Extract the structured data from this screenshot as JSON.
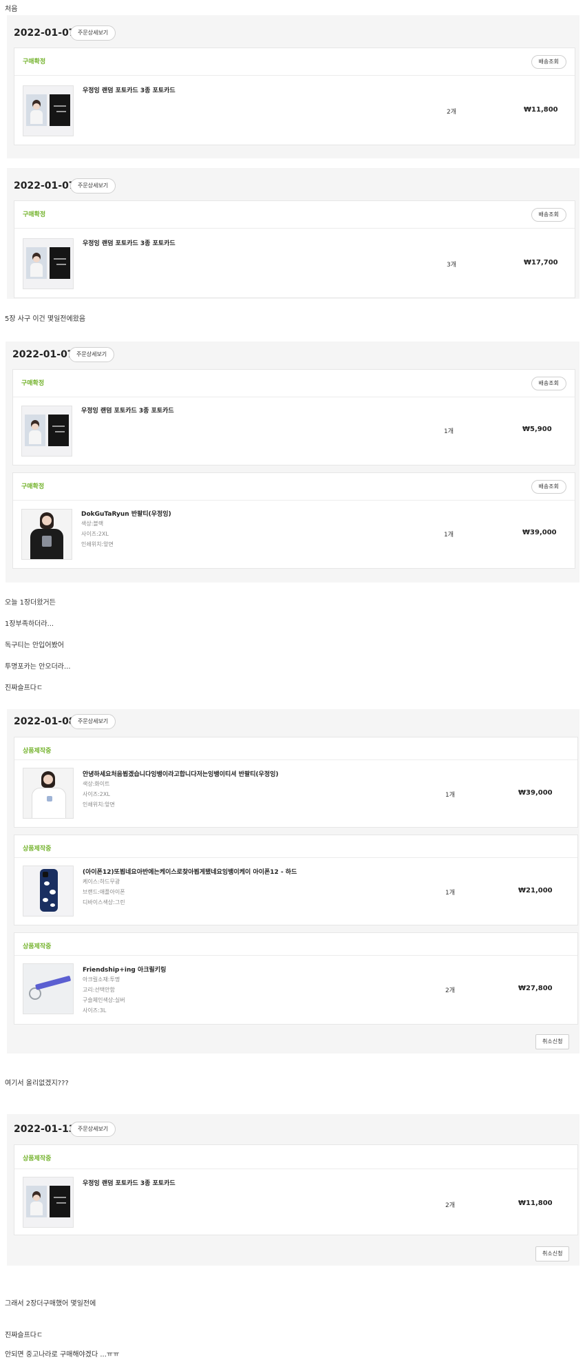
{
  "post_lines": {
    "l1": "처음",
    "l2": "5장 사구 이건 몇일전에왔음",
    "l3": "오늘 1장더왔거든",
    "l4": "1장부족하더라...",
    "l5": "독구티는 안입어봤어",
    "l6": "투명포카는 안오더라...",
    "l7": "진짜슬프다ㄷ",
    "l8": "여기서 올리없겠지???",
    "l9": "그래서 2장더구매했어 몇일전에",
    "l10": "진짜슬프다ㄷ",
    "l11": "안되면 중고나라로 구매해야겠다 ...ㅠㅠ"
  },
  "labels": {
    "order_detail": "주문상세보기",
    "track": "배송조회",
    "cancel": "취소신청",
    "confirmed": "구매확정",
    "in_production": "상품제작중"
  },
  "orders": [
    {
      "date": "2022-01-07",
      "items": [
        {
          "name": "우정잉 랜덤 포토카드 3종 포토카드",
          "qty": "2개",
          "price": "₩11,800"
        }
      ]
    },
    {
      "date": "2022-01-07",
      "items": [
        {
          "name": "우정잉 랜덤 포토카드 3종 포토카드",
          "qty": "3개",
          "price": "₩17,700"
        }
      ]
    },
    {
      "date": "2022-01-07",
      "items": [
        {
          "name": "우정잉 랜덤 포토카드 3종 포토카드",
          "qty": "1개",
          "price": "₩5,900"
        },
        {
          "name": "DokGuTaRyun 반팔티(우정잉)",
          "options": [
            "색상:블랙",
            "사이즈:2XL",
            "인쇄위치:앞면"
          ],
          "qty": "1개",
          "price": "₩39,000"
        }
      ]
    },
    {
      "date": "2022-01-08",
      "items": [
        {
          "name": "안녕하세요처음뵙겠습니다잉뱅이라고합니다저는잉뱅이티셔 반팔티(우정잉)",
          "options": [
            "색상:화이트",
            "사이즈:2XL",
            "인쇄위치:앞면"
          ],
          "qty": "1개",
          "price": "₩39,000"
        },
        {
          "name": "(아이폰12)또뵙네요아반에는케이스로찾아뵙게됐네요잉뱅이케이 아이폰12 - 하드",
          "options": [
            "케이스:하드무광",
            "브랜드:애플아이폰",
            "디바이스색상:그린"
          ],
          "qty": "1개",
          "price": "₩21,000"
        },
        {
          "name": "Friendship+ing 아크릴키링",
          "options": [
            "아크릴소재:투명",
            "고리:선택안함",
            "구슬체인색상:실버",
            "사이즈:3L"
          ],
          "qty": "2개",
          "price": "₩27,800"
        }
      ]
    },
    {
      "date": "2022-01-13",
      "items": [
        {
          "name": "우정잉 랜덤 포토카드 3종 포토카드",
          "qty": "2개",
          "price": "₩11,800"
        }
      ]
    }
  ],
  "colors": {
    "status_green": "#74b32d",
    "panel_bg": "#f5f5f5"
  },
  "icons": [
    "photocard-thumbnail",
    "tshirt-black-thumbnail",
    "tshirt-white-thumbnail",
    "phone-case-thumbnail",
    "acrylic-keyring-thumbnail"
  ]
}
